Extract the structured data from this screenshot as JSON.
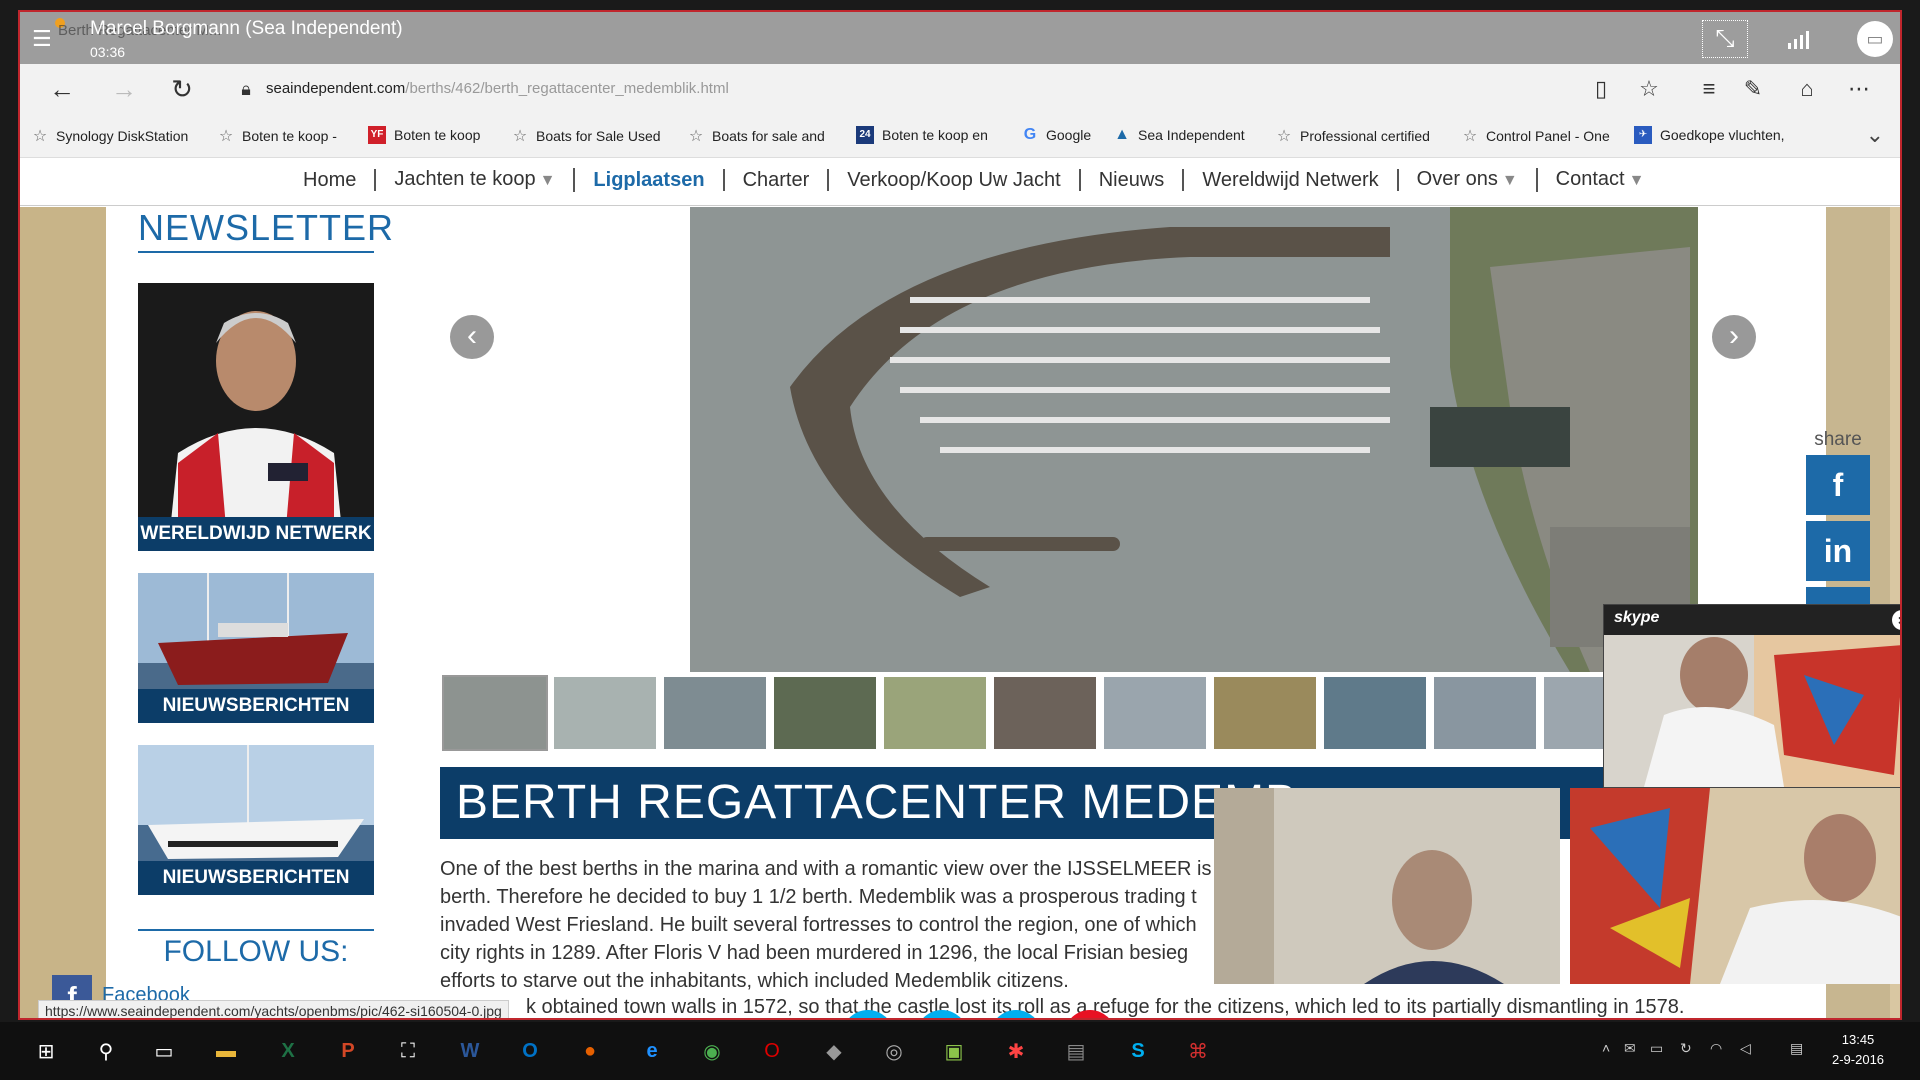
{
  "call": {
    "caller": "Marcel Borgmann (Sea Independent)",
    "timer": "03:36",
    "tab_ghost": "Berth Regattacenter M..."
  },
  "browser": {
    "url_domain": "seaindependent.com",
    "url_path": "/berths/462/berth_regattacenter_medemblik.html"
  },
  "bookmarks": [
    {
      "label": "Synology DiskStation",
      "icon": "star-icon"
    },
    {
      "label": "Boten te koop -",
      "icon": "star-icon"
    },
    {
      "label": "Boten te koop",
      "icon": "yf-icon"
    },
    {
      "label": "Boats for Sale  Used",
      "icon": "star-icon"
    },
    {
      "label": "Boats for sale and",
      "icon": "star-icon"
    },
    {
      "label": "Boten te koop en",
      "icon": "24-icon"
    },
    {
      "label": "Google",
      "icon": "google-icon"
    },
    {
      "label": "Sea Independent",
      "icon": "sea-icon"
    },
    {
      "label": "Professional certified",
      "icon": "star-icon"
    },
    {
      "label": "Control Panel - One",
      "icon": "star-icon"
    },
    {
      "label": "Goedkope vluchten,",
      "icon": "flight-icon"
    }
  ],
  "nav": {
    "items": [
      {
        "label": "Home",
        "caret": false
      },
      {
        "label": "Jachten te koop",
        "caret": true
      },
      {
        "label": "Ligplaatsen",
        "caret": false,
        "active": true
      },
      {
        "label": "Charter",
        "caret": false
      },
      {
        "label": "Verkoop/Koop Uw Jacht",
        "caret": false
      },
      {
        "label": "Nieuws",
        "caret": false
      },
      {
        "label": "Wereldwijd Netwerk",
        "caret": false
      },
      {
        "label": "Over ons",
        "caret": true
      },
      {
        "label": "Contact",
        "caret": true
      }
    ]
  },
  "sidebar": {
    "newsletter_title": "NEWSLETTER",
    "promo1_label": "WERELDWIJD NETWERK",
    "promo2_label": "NIEUWSBERICHTEN",
    "promo3_label": "NIEUWSBERICHTEN",
    "follow_title": "FOLLOW US:",
    "facebook_label": "Facebook"
  },
  "main": {
    "title": "BERTH REGATTACENTER MEDEMB",
    "description": [
      "One of the best berths in the marina and with a romantic view over the IJSSELMEER is",
      "berth. Therefore he decided to buy 1 1/2 berth. Medemblik was a prosperous trading t",
      "invaded West Friesland. He built several fortresses to control the region, one of which",
      "city rights in 1289. After Floris V had been murdered in 1296, the local Frisian besieg",
      "efforts to starve out the inhabitants, which included Medemblik citizens."
    ],
    "description_last": "k obtained town walls in 1572, so that the castle lost its roll as a refuge for the citizens, which led to its partially dismantling in 1578."
  },
  "share": {
    "label": "share"
  },
  "status_url": "https://www.seaindependent.com/yachts/openbms/pic/462-si160504-0.jpg",
  "skype": {
    "logo": "skype"
  },
  "taskbar": {
    "time": "13:45",
    "date": "2-9-2016"
  },
  "colors": {
    "brand_blue": "#0c3d68",
    "link_blue": "#1d6aa8",
    "end_call_red": "#e81123",
    "call_blue": "#00aff0"
  }
}
